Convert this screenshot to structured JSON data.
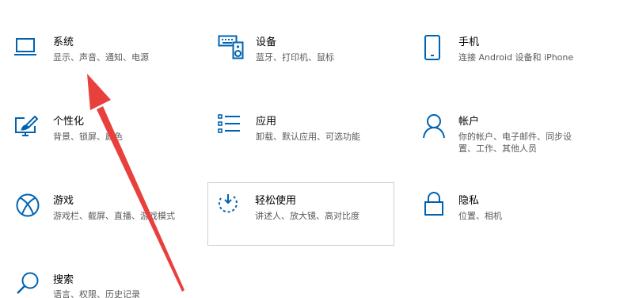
{
  "settings": {
    "system": {
      "title": "系统",
      "desc": "显示、声音、通知、电源",
      "icon": "laptop-icon"
    },
    "devices": {
      "title": "设备",
      "desc": "蓝牙、打印机、鼠标",
      "icon": "keyboard-speaker-icon"
    },
    "phone": {
      "title": "手机",
      "desc": "连接 Android 设备和 iPhone",
      "icon": "phone-icon"
    },
    "personalization": {
      "title": "个性化",
      "desc": "背景、锁屏、颜色",
      "icon": "paintbrush-monitor-icon"
    },
    "apps": {
      "title": "应用",
      "desc": "卸载、默认应用、可选功能",
      "icon": "app-list-icon"
    },
    "accounts": {
      "title": "帐户",
      "desc_line1": "你的帐户、电子邮件、同步设",
      "desc_line2": "置、工作、其他人员",
      "icon": "person-icon"
    },
    "gaming": {
      "title": "游戏",
      "desc": "游戏栏、截屏、直播、游戏模式",
      "icon": "xbox-icon"
    },
    "ease_of_access": {
      "title": "轻松使用",
      "desc": "讲述人、放大镜、高对比度",
      "icon": "ease-of-access-icon"
    },
    "privacy": {
      "title": "隐私",
      "desc": "位置、相机",
      "icon": "lock-icon"
    },
    "search": {
      "title": "搜索",
      "desc": "语言、权限、历史记录",
      "icon": "search-icon"
    }
  },
  "accent_color": "#0063b1",
  "annotation_arrow_color": "#e8413d"
}
